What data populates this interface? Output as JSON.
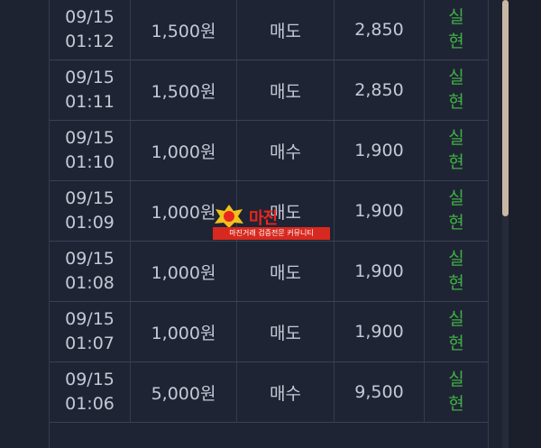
{
  "rows": [
    {
      "date": "09/15",
      "time": "01:12",
      "amount": "1,500원",
      "type": "매도",
      "price": "2,850",
      "status_1": "실",
      "status_2": "현"
    },
    {
      "date": "09/15",
      "time": "01:11",
      "amount": "1,500원",
      "type": "매도",
      "price": "2,850",
      "status_1": "실",
      "status_2": "현"
    },
    {
      "date": "09/15",
      "time": "01:10",
      "amount": "1,000원",
      "type": "매수",
      "price": "1,900",
      "status_1": "실",
      "status_2": "현"
    },
    {
      "date": "09/15",
      "time": "01:09",
      "amount": "1,000원",
      "type": "매도",
      "price": "1,900",
      "status_1": "실",
      "status_2": "현"
    },
    {
      "date": "09/15",
      "time": "01:08",
      "amount": "1,000원",
      "type": "매도",
      "price": "1,900",
      "status_1": "실",
      "status_2": "현"
    },
    {
      "date": "09/15",
      "time": "01:07",
      "amount": "1,000원",
      "type": "매도",
      "price": "1,900",
      "status_1": "실",
      "status_2": "현"
    },
    {
      "date": "09/15",
      "time": "01:06",
      "amount": "5,000원",
      "type": "매수",
      "price": "9,500",
      "status_1": "실",
      "status_2": "현"
    }
  ],
  "watermark": {
    "title": "마진",
    "bar_text": "마진거래 검증전문 커뮤니티"
  },
  "colors": {
    "status": "#3fb045",
    "text": "#c4c9d6",
    "background": "#1f2434",
    "watermark": "#d7291f"
  }
}
